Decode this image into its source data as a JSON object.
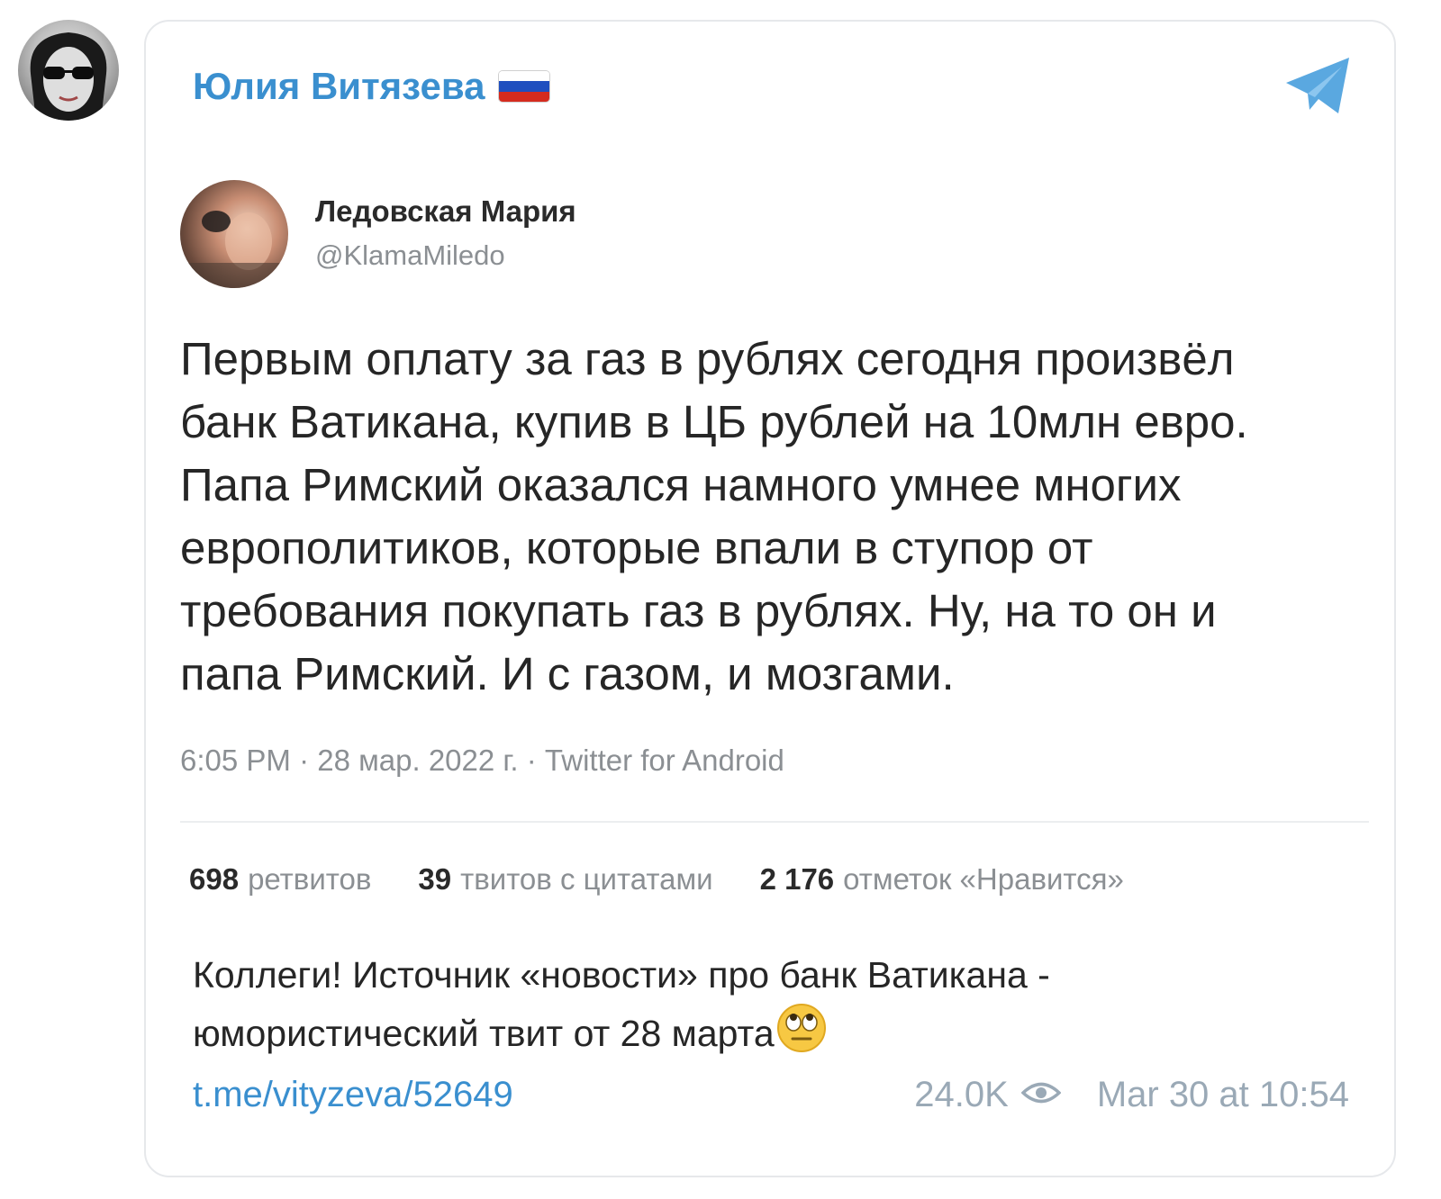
{
  "channel": {
    "name": "Юлия Витязева",
    "flag_icon": "russia-flag-icon",
    "app_icon": "telegram-icon"
  },
  "tweet": {
    "author_name": "Ледовская Мария",
    "author_handle": "@KlamaMiledo",
    "text": "Первым оплату за газ в рублях сегодня произвёл\nбанк Ватикана, купив в ЦБ рублей на 10млн евро.\nПапа Римский оказался намного умнее многих\nеврополитиков, которые впали в ступор от\nтребования покупать газ в рублях. Ну, на то он и\nпапа Римский. И с газом, и мозгами.",
    "meta": "6:05 PM · 28 мар. 2022 г. · Twitter for Android",
    "stats": {
      "retweets_count": "698",
      "retweets_label": "ретвитов",
      "quotes_count": "39",
      "quotes_label": "твитов с цитатами",
      "likes_count": "2 176",
      "likes_label": "отметок «Нравится»"
    }
  },
  "post": {
    "text": "Коллеги! Источник «новости» про банк Ватикана - юмористический твит от 28 марта",
    "emoji": "face-with-rolling-eyes-icon",
    "link": "t.me/vityzeva/52649",
    "views": "24.0K",
    "timestamp": "Mar 30 at 10:54"
  },
  "colors": {
    "accent": "#3a8fcf",
    "text": "#262626",
    "muted": "#8b8f93",
    "footer": "#9aa9b6"
  }
}
